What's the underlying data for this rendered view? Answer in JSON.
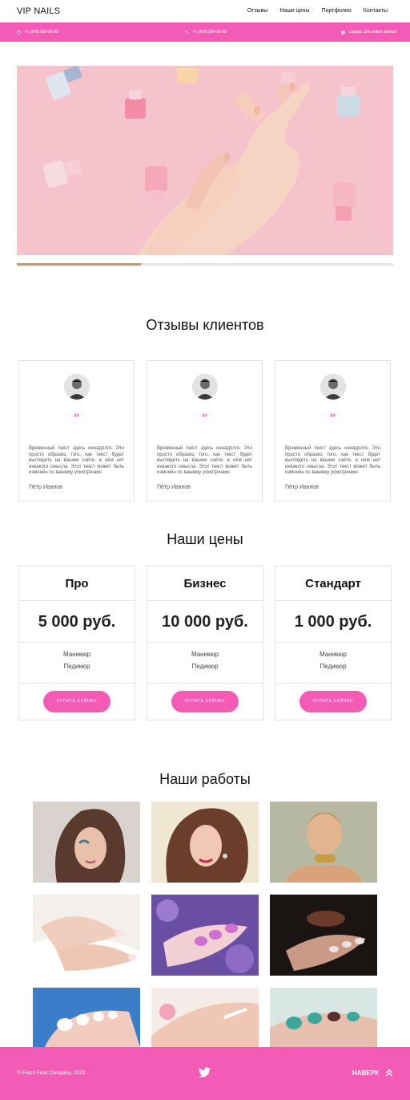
{
  "header": {
    "logo": "VIP NAILS",
    "nav": [
      "Отзывы",
      "Наши цены",
      "Портфолио",
      "Контакты"
    ]
  },
  "infobar": {
    "phone1": "+7 (999) 999-99-99",
    "phone2": "+7 (999) 999-99-99",
    "promo": "Скидка 15% online записи"
  },
  "slider": {
    "progress": 0.33
  },
  "reviews": {
    "title": "Отзывы клиентов",
    "items": [
      {
        "text": "Временный текст здесь ненадолго. Это просто образец того, как текст будет выглядеть на вашем сайте, в нём нет никакого смысла. Этот текст может быть изменён по вашему усмотрению.",
        "author": "Пётр Иванов"
      },
      {
        "text": "Временный текст здесь ненадолго. Это просто образец того, как текст будет выглядеть на вашем сайте, в нём нет никакого смысла. Этот текст может быть изменён по вашему усмотрению.",
        "author": "Пётр Иванов"
      },
      {
        "text": "Временный текст здесь ненадолго. Это просто образец того, как текст будет выглядеть на вашем сайте, в нём нет никакого смысла. Этот текст может быть изменён по вашему усмотрению.",
        "author": "Пётр Иванов"
      }
    ],
    "quote_mark": "“"
  },
  "prices": {
    "title": "Наши цены",
    "plans": [
      {
        "name": "Про",
        "price": "5 000 руб.",
        "features": [
          "Маникюр",
          "Педикюр"
        ],
        "button": "КУПИТЬ СЕЙЧАС"
      },
      {
        "name": "Бизнес",
        "price": "10 000 руб.",
        "features": [
          "Маникюр",
          "Педикюр"
        ],
        "button": "КУПИТЬ СЕЙЧАС"
      },
      {
        "name": "Стандарт",
        "price": "1 000 руб.",
        "features": [
          "Маникюр",
          "Педикюр"
        ],
        "button": "КУПИТЬ СЕЙЧАС"
      }
    ]
  },
  "works": {
    "title": "Наши работы"
  },
  "footer": {
    "copyright": "© Fresh Fruit Company, 2023",
    "to_top": "НАВЕРХ"
  },
  "colors": {
    "accent": "#f45bb6",
    "slider_fill": "#b9987b"
  }
}
